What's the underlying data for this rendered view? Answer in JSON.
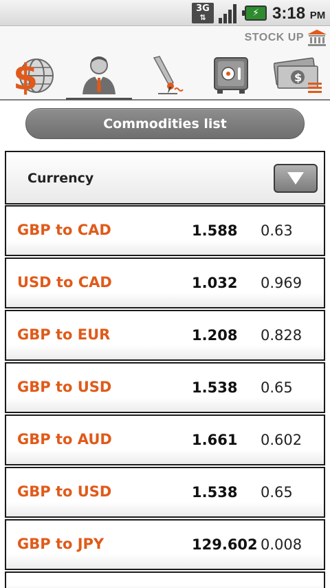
{
  "status_bar": {
    "network_label": "3G",
    "time": "3:18",
    "ampm": "PM"
  },
  "header": {
    "brand": "STOCK UP",
    "tabs": [
      {
        "id": "globe-dollar",
        "icon": "globe-dollar-icon"
      },
      {
        "id": "advisor",
        "icon": "businessman-icon"
      },
      {
        "id": "signing",
        "icon": "pen-sign-icon"
      },
      {
        "id": "safe",
        "icon": "safe-icon"
      },
      {
        "id": "money",
        "icon": "money-stack-icon"
      }
    ],
    "accent": "#e05a1a"
  },
  "commodities_button": "Commodities list",
  "selector": {
    "label": "Currency"
  },
  "rates": [
    {
      "pair": "GBP to CAD",
      "rate": "1.588",
      "inverse": "0.63"
    },
    {
      "pair": "USD to CAD",
      "rate": "1.032",
      "inverse": "0.969"
    },
    {
      "pair": "GBP to EUR",
      "rate": "1.208",
      "inverse": "0.828"
    },
    {
      "pair": "GBP to USD",
      "rate": "1.538",
      "inverse": "0.65"
    },
    {
      "pair": "GBP to AUD",
      "rate": "1.661",
      "inverse": "0.602"
    },
    {
      "pair": "GBP to USD",
      "rate": "1.538",
      "inverse": "0.65"
    },
    {
      "pair": "GBP to JPY",
      "rate": "129.602",
      "inverse": "0.008"
    }
  ]
}
